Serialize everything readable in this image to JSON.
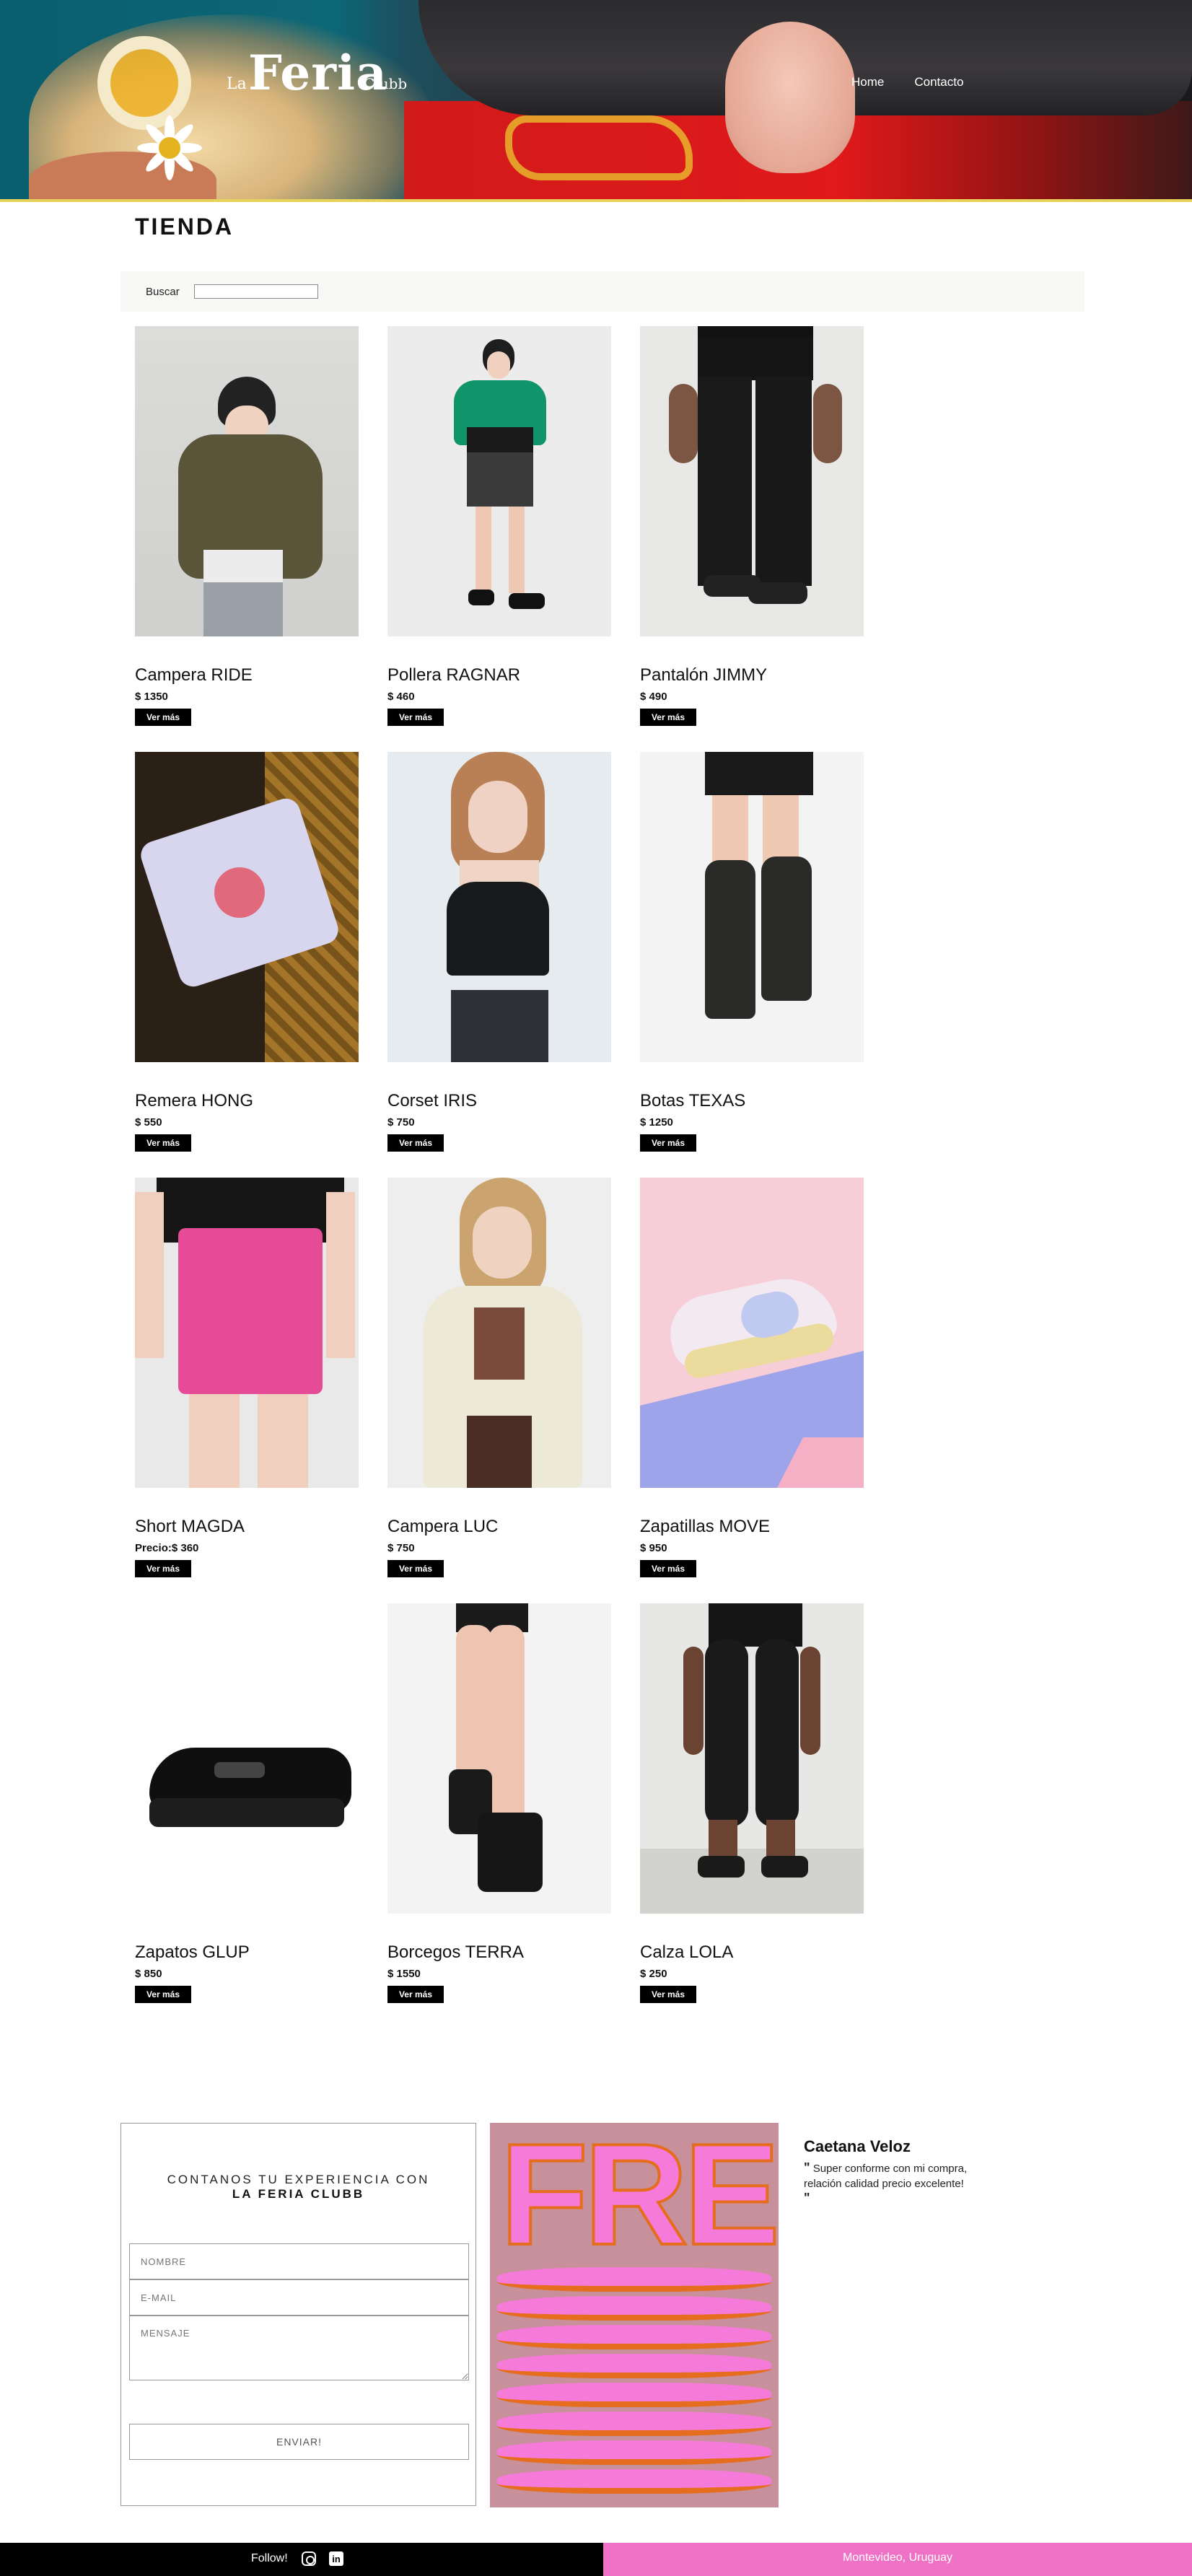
{
  "header": {
    "logo": {
      "la": "La",
      "feria": "Feria",
      "clubb": "Clubb"
    },
    "nav": [
      {
        "label": "Home"
      },
      {
        "label": "Contacto"
      }
    ]
  },
  "shop": {
    "title": "TIENDA",
    "search_label": "Buscar",
    "search_value": "",
    "button_label": "Ver más",
    "products": [
      {
        "name": "Campera RIDE",
        "price": "$ 1350"
      },
      {
        "name": "Pollera RAGNAR",
        "price": "$ 460"
      },
      {
        "name": "Pantalón JIMMY",
        "price": "$ 490"
      },
      {
        "name": "Remera HONG",
        "price": "$ 550"
      },
      {
        "name": "Corset IRIS",
        "price": "$ 750"
      },
      {
        "name": "Botas TEXAS",
        "price": "$ 1250"
      },
      {
        "name": "Short MAGDA",
        "price": "Precio:$ 360"
      },
      {
        "name": "Campera LUC",
        "price": "$ 750"
      },
      {
        "name": "Zapatillas MOVE",
        "price": "$ 950"
      },
      {
        "name": "Zapatos GLUP",
        "price": "$ 850"
      },
      {
        "name": "Borcegos TERRA",
        "price": "$ 1550"
      },
      {
        "name": "Calza LOLA",
        "price": "$ 250"
      }
    ]
  },
  "contact_form": {
    "title_line1": "CONTANOS TU EXPERIENCIA CON",
    "title_line2": "LA FERIA CLUBB",
    "name_placeholder": "NOMBRE",
    "email_placeholder": "E-MAIL",
    "message_placeholder": "MENSAJE",
    "submit_label": "ENVIAR!"
  },
  "poster": {
    "text": "FREE"
  },
  "testimonial": {
    "name": "Caetana Veloz",
    "open_quote": "\"",
    "text": "Super conforme con mi compra, relación calidad precio excelente!",
    "close_quote": "\""
  },
  "footer": {
    "follow_label": "Follow!",
    "linkedin_label": "in",
    "location": "Montevideo, Uruguay"
  },
  "icons": [
    "instagram-icon",
    "linkedin-icon"
  ],
  "colors": {
    "accent_pink": "#f072c6",
    "footer_black": "#000000",
    "button_black": "#000000"
  }
}
